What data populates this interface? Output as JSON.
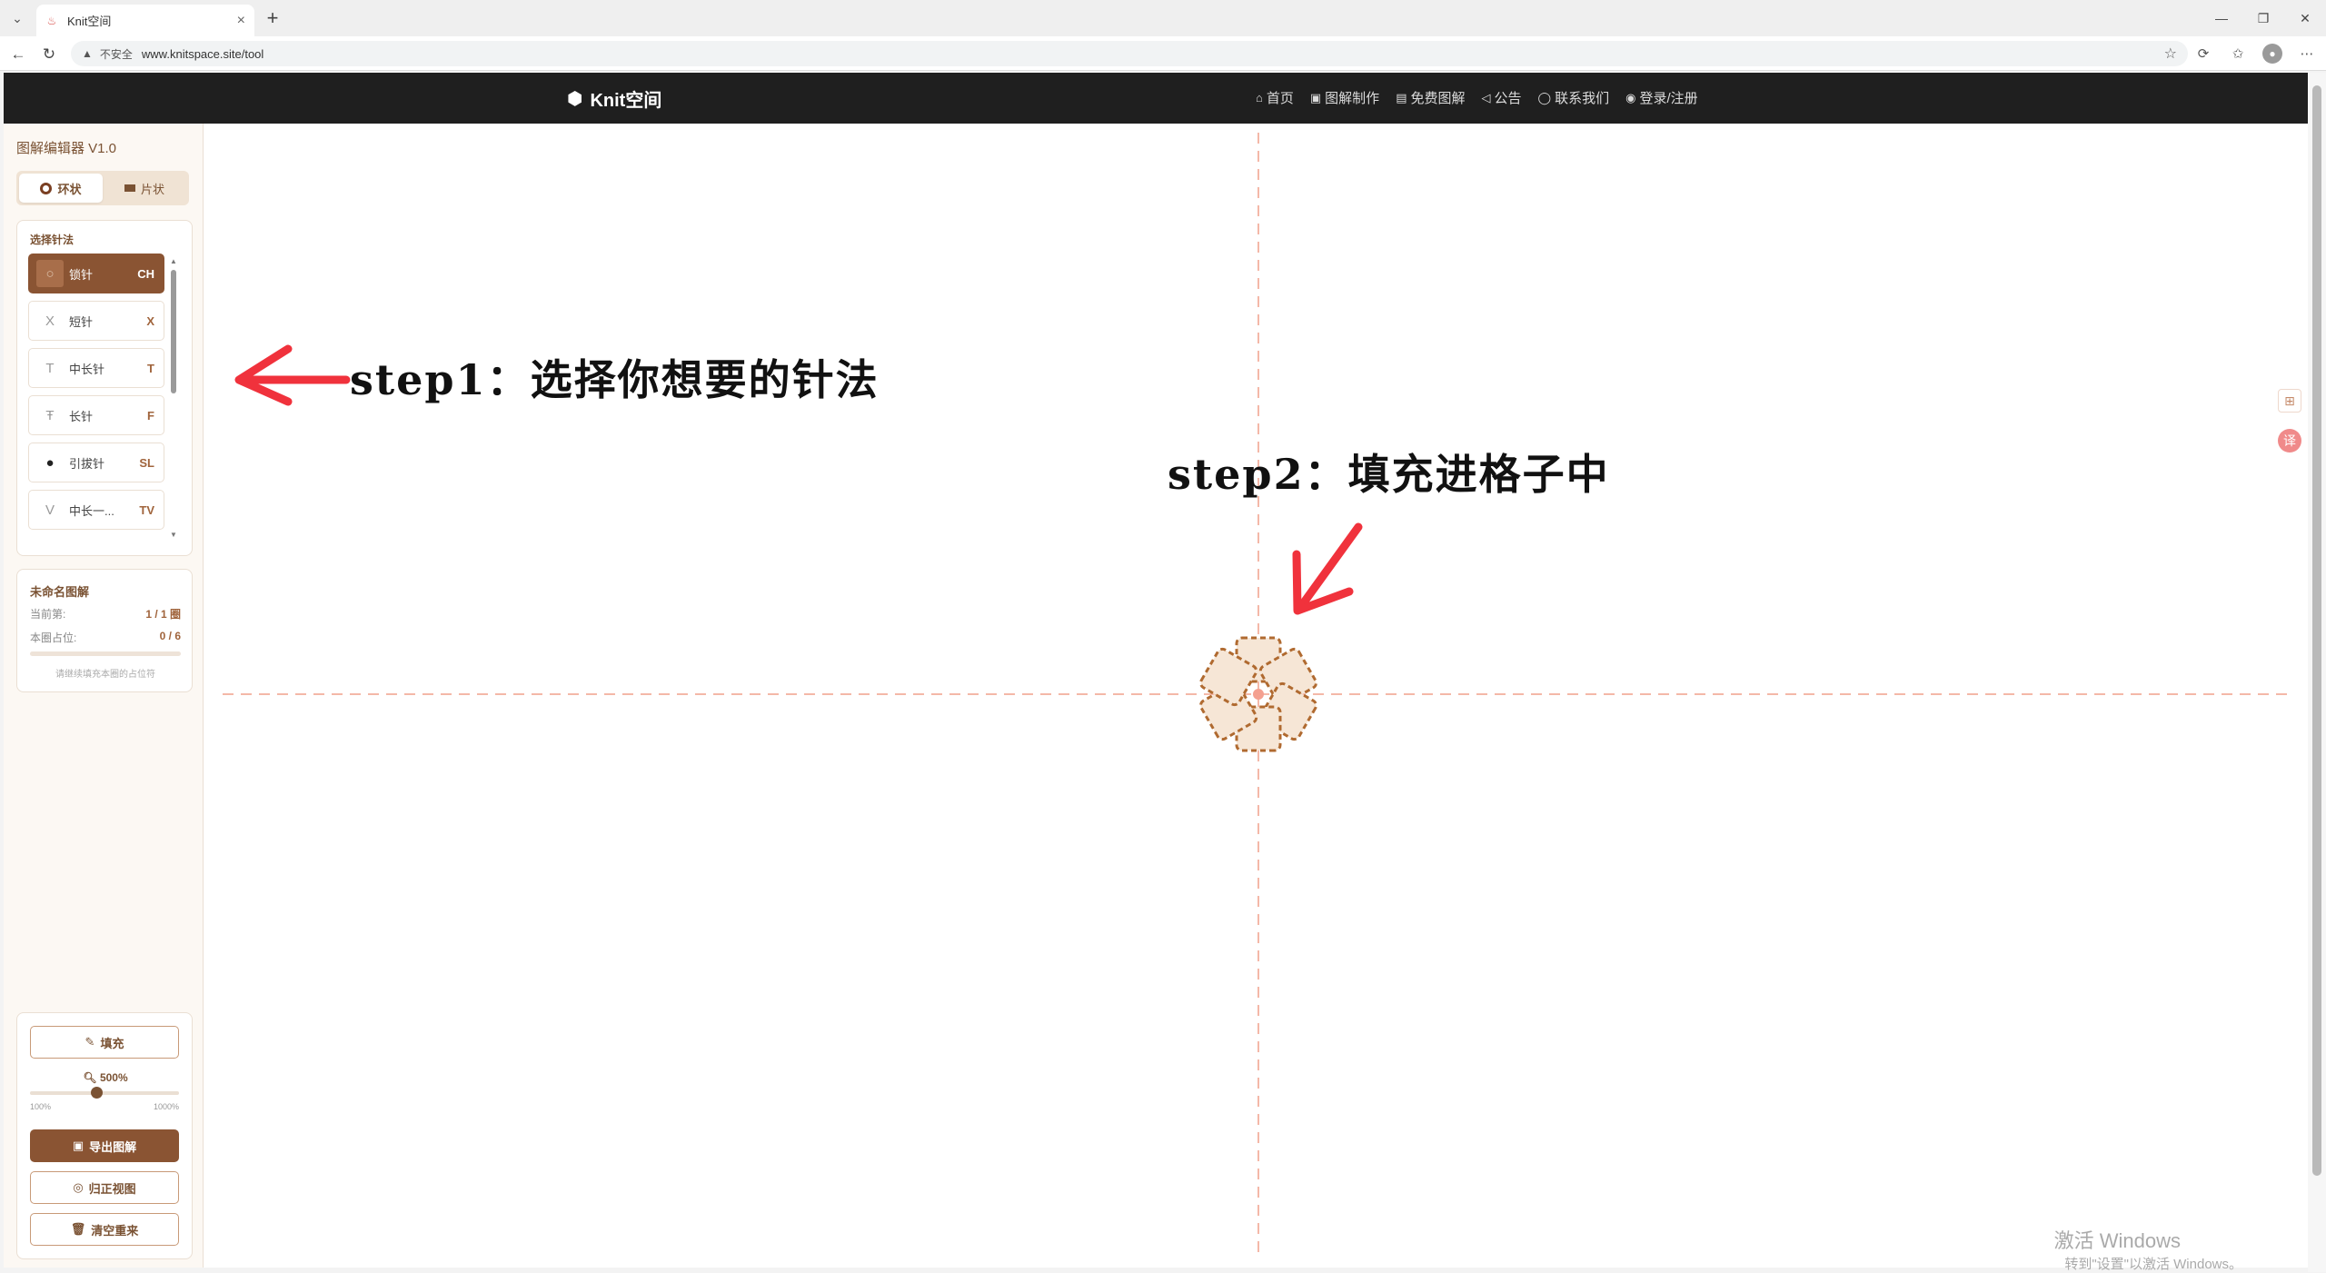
{
  "browser": {
    "tab_title": "Knit空间",
    "insecure_label": "不安全",
    "url": "www.knitspace.site/tool"
  },
  "site": {
    "logo": "Knit空间",
    "nav": [
      {
        "label": "首页",
        "icon": "home-icon"
      },
      {
        "label": "图解制作",
        "icon": "edit-icon"
      },
      {
        "label": "免费图解",
        "icon": "book-icon"
      },
      {
        "label": "公告",
        "icon": "megaphone-icon"
      },
      {
        "label": "联系我们",
        "icon": "chat-icon"
      },
      {
        "label": "登录/注册",
        "icon": "user-icon"
      }
    ]
  },
  "sidebar": {
    "title": "图解编辑器 V1.0",
    "modes": [
      {
        "label": "环状",
        "active": true
      },
      {
        "label": "片状",
        "active": false
      }
    ],
    "stitch_title": "选择针法",
    "stitches": [
      {
        "symbol": "○",
        "name": "锁针",
        "code": "CH",
        "active": true
      },
      {
        "symbol": "X",
        "name": "短针",
        "code": "X",
        "active": false
      },
      {
        "symbol": "T",
        "name": "中长针",
        "code": "T",
        "active": false
      },
      {
        "symbol": "Ŧ",
        "name": "长针",
        "code": "F",
        "active": false
      },
      {
        "symbol": "●",
        "name": "引拔针",
        "code": "SL",
        "active": false
      },
      {
        "symbol": "V",
        "name": "中长一...",
        "code": "TV",
        "active": false
      }
    ],
    "info": {
      "title": "未命名图解",
      "current_label": "当前第:",
      "current_value": "1 / 1 圈",
      "occupied_label": "本圈占位:",
      "occupied_value": "0 / 6",
      "progress": 0,
      "hint": "请继续填充本圈的占位符"
    },
    "actions": {
      "fill": "填充",
      "zoom": "500%",
      "zoom_value": 500,
      "zoom_min": "100%",
      "zoom_max": "1000%",
      "export": "导出图解",
      "reset_view": "归正视图",
      "clear": "清空重来"
    }
  },
  "annotations": {
    "step1": "step1：选择你想要的针法",
    "step2": "step2：填充进格子中"
  },
  "watermark": {
    "line1": "激活 Windows",
    "line2": "转到\"设置\"以激活 Windows。"
  },
  "colors": {
    "accent": "#8a5433",
    "arrow": "#f0323c",
    "guide": "#f4b8a8",
    "placeholder_fill": "#f6e6d6",
    "placeholder_stroke": "#b06a30"
  }
}
